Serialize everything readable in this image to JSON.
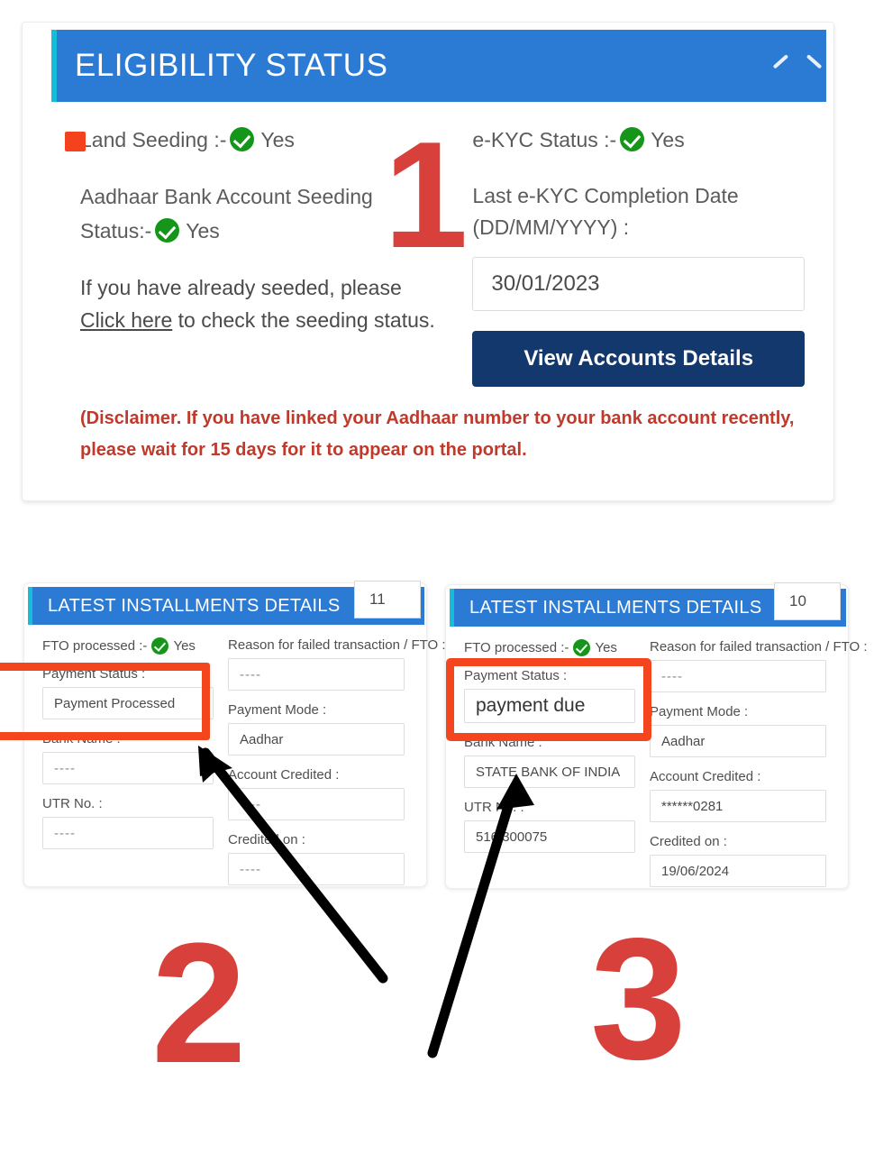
{
  "theme": {
    "header_blue": "#2b7bd4",
    "header_accent_cyan": "#17bcd8",
    "button_navy": "#12386e",
    "check_green": "#15961b",
    "highlight_red": "#f4461e",
    "step_number_red": "#d8413b",
    "disclaimer_red": "#c0392b"
  },
  "eligibility_panel": {
    "header": {
      "title": "ELIGIBILITY STATUS",
      "collapse_icon": "chevron-up-icon"
    },
    "left_column": {
      "land_seeding": {
        "label": "Land Seeding :-",
        "status_icon": "green-check-icon",
        "value": "Yes"
      },
      "aadhaar_bank_seeding": {
        "label": "Aadhaar Bank Account Seeding Status:-",
        "label_line_1": "Aadhaar Bank Account Seeding",
        "label_line_2": "Status:-",
        "status_icon": "green-check-icon",
        "value": "Yes"
      },
      "seeding_note": {
        "before_link": "If you have already seeded, please ",
        "link_text": "Click here",
        "after_link": " to check the seeding status."
      }
    },
    "right_column": {
      "ekyc_status": {
        "label": "e-KYC Status :-",
        "status_icon": "green-check-icon",
        "value": "Yes"
      },
      "last_ekyc_date": {
        "label_line_1": "Last e-KYC Completion Date",
        "label_line_2": "(DD/MM/YYYY) :",
        "value": "30/01/2023"
      },
      "view_accounts_button": "View Accounts Details"
    },
    "disclaimer": "(Disclaimer. If you have linked your Aadhaar number to your bank account recently, please wait for 15 days for it to appear on the portal."
  },
  "installment_cards": [
    {
      "header_title": "LATEST INSTALLMENTS DETAILS",
      "installment_number": "11",
      "fto_processed": {
        "label": "FTO processed :-",
        "status_icon": "green-check-icon",
        "value": "Yes"
      },
      "fields_left": [
        {
          "label": "Payment Status :",
          "value": "Payment Processed",
          "emphasis": false
        },
        {
          "label": "Bank Name :",
          "value": "----",
          "emphasis": false
        },
        {
          "label": "UTR No. :",
          "value": "----",
          "emphasis": false
        }
      ],
      "fields_right": [
        {
          "label": "Reason for failed transaction / FTO :",
          "value": "----"
        },
        {
          "label": "Payment Mode :",
          "value": "Aadhar"
        },
        {
          "label": "Account Credited :",
          "value": "----"
        },
        {
          "label": "Credited on :",
          "value": "----"
        }
      ]
    },
    {
      "header_title": "LATEST INSTALLMENTS DETAILS",
      "installment_number": "10",
      "fto_processed": {
        "label": "FTO processed :-",
        "status_icon": "green-check-icon",
        "value": "Yes"
      },
      "fields_left": [
        {
          "label": "Payment Status :",
          "value": "payment due",
          "emphasis": true
        },
        {
          "label": "Bank Name :",
          "value": "STATE BANK OF INDIA",
          "emphasis": false
        },
        {
          "label": "UTR No. :",
          "value": "516 300075",
          "emphasis": false
        }
      ],
      "fields_right": [
        {
          "label": "Reason for failed transaction / FTO :",
          "value": "----"
        },
        {
          "label": "Payment Mode :",
          "value": "Aadhar"
        },
        {
          "label": "Account Credited :",
          "value": "******0281"
        },
        {
          "label": "Credited on :",
          "value": "19/06/2024"
        }
      ]
    }
  ],
  "annotations": {
    "step_numbers": [
      "1",
      "2",
      "3"
    ],
    "highlight_boxes": [
      "payment-status-highlight-card-11",
      "payment-status-highlight-card-10"
    ],
    "arrows": [
      "arrow-pointing-to-card-11-bank-name",
      "arrow-pointing-to-card-10-bank-name"
    ]
  }
}
